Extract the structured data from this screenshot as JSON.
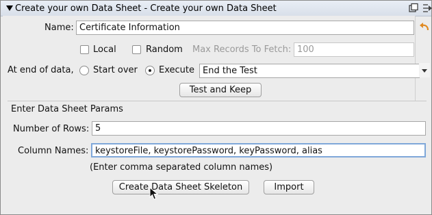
{
  "title": "Create your own Data Sheet - Create your own Data Sheet",
  "name_label": "Name:",
  "name_value": "Certificate Information",
  "local_label": "Local",
  "random_label": "Random",
  "max_records_label": "Max Records To Fetch:",
  "max_records_value": "100",
  "end_label": "At end of data,",
  "start_over_label": "Start over",
  "execute_label": "Execute",
  "execute_selected": true,
  "execute_value": "End the Test",
  "test_keep_label": "Test and Keep",
  "params_heading": "Enter Data Sheet Params",
  "rows_label": "Number of Rows:",
  "rows_value": "5",
  "columns_label": "Column Names:",
  "columns_value": "keystoreFile, keystorePassword, keyPassword, alias",
  "columns_hint": "(Enter comma separated column names)",
  "create_label": "Create Data Sheet Skeleton",
  "import_label": "Import",
  "colors": {
    "accent": "#f2a23a",
    "title_bg": "#dfe5ee"
  },
  "icons": [
    "collapse-triangle-icon",
    "restore-window-icon",
    "next-arrow-icon",
    "undo-arrow-icon",
    "dropdown-arrow-icon",
    "mouse-cursor-icon"
  ]
}
